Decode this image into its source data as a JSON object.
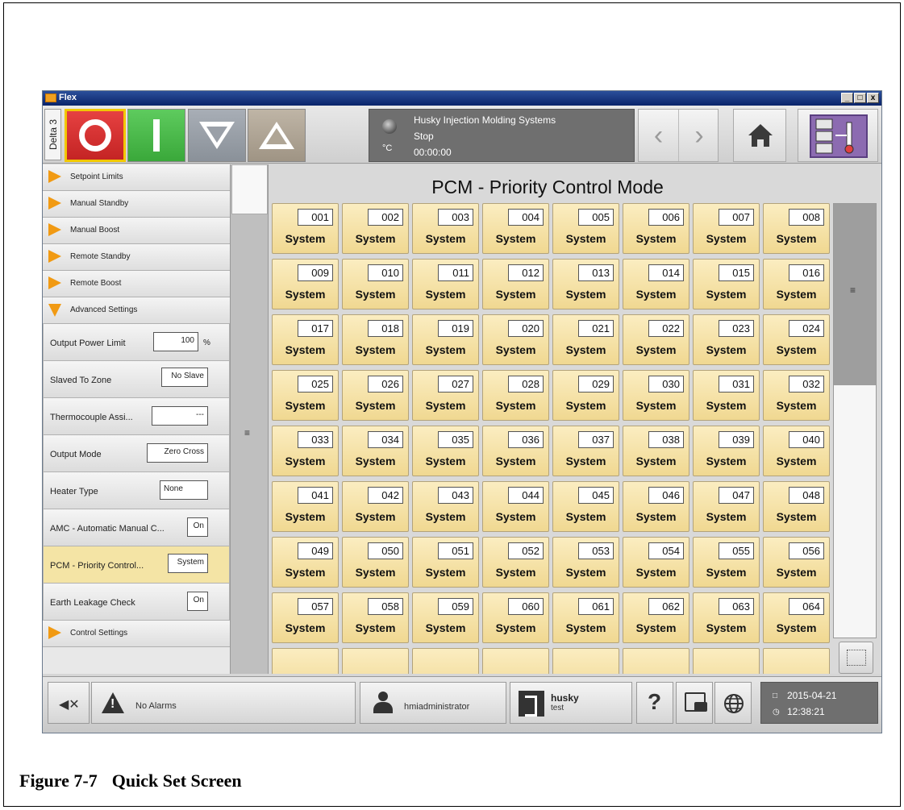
{
  "window": {
    "title": "Flex",
    "controls": {
      "minimize": "_",
      "maximize": "□",
      "close": "x"
    }
  },
  "topbar": {
    "delta_tab": "Delta 3",
    "status": {
      "company": "Husky Injection Molding Systems",
      "state": "Stop",
      "timer": "00:00:00",
      "unit": "°C"
    },
    "colors": {
      "stop": "#d83030",
      "start": "#4bbd4b",
      "stop_border": "#f2c700",
      "monitor": "#8c6bb1"
    },
    "icons": [
      "stop-icon",
      "start-icon",
      "decrease-icon",
      "increase-icon",
      "back-icon",
      "forward-icon",
      "home-icon",
      "temperature-monitor-icon"
    ]
  },
  "sidebar": {
    "menu": [
      {
        "label": "Setpoint Limits",
        "expanded": false
      },
      {
        "label": "Manual Standby",
        "expanded": false
      },
      {
        "label": "Manual Boost",
        "expanded": false
      },
      {
        "label": "Remote Standby",
        "expanded": false
      },
      {
        "label": "Remote Boost",
        "expanded": false
      },
      {
        "label": "Advanced Settings",
        "expanded": true
      }
    ],
    "props": [
      {
        "label": "Output Power Limit",
        "value": "100",
        "unit": "%"
      },
      {
        "label": "Slaved To Zone",
        "value": "No Slave"
      },
      {
        "label": "Thermocouple Assi...",
        "value": "---"
      },
      {
        "label": "Output Mode",
        "value": "Zero Cross"
      },
      {
        "label": "Heater Type",
        "value": "None"
      },
      {
        "label": "AMC - Automatic Manual C...",
        "value": "On"
      },
      {
        "label": "PCM - Priority Control...",
        "value": "System",
        "selected": true
      },
      {
        "label": "Earth Leakage Check",
        "value": "On"
      }
    ],
    "footer_menu": {
      "label": "Control Settings"
    },
    "scroll_grip": "≡"
  },
  "main": {
    "title": "PCM - Priority Control Mode",
    "zones": [
      {
        "num": "001",
        "label": "System"
      },
      {
        "num": "002",
        "label": "System"
      },
      {
        "num": "003",
        "label": "System"
      },
      {
        "num": "004",
        "label": "System"
      },
      {
        "num": "005",
        "label": "System"
      },
      {
        "num": "006",
        "label": "System"
      },
      {
        "num": "007",
        "label": "System"
      },
      {
        "num": "008",
        "label": "System"
      },
      {
        "num": "009",
        "label": "System"
      },
      {
        "num": "010",
        "label": "System"
      },
      {
        "num": "011",
        "label": "System"
      },
      {
        "num": "012",
        "label": "System"
      },
      {
        "num": "013",
        "label": "System"
      },
      {
        "num": "014",
        "label": "System"
      },
      {
        "num": "015",
        "label": "System"
      },
      {
        "num": "016",
        "label": "System"
      },
      {
        "num": "017",
        "label": "System"
      },
      {
        "num": "018",
        "label": "System"
      },
      {
        "num": "019",
        "label": "System"
      },
      {
        "num": "020",
        "label": "System"
      },
      {
        "num": "021",
        "label": "System"
      },
      {
        "num": "022",
        "label": "System"
      },
      {
        "num": "023",
        "label": "System"
      },
      {
        "num": "024",
        "label": "System"
      },
      {
        "num": "025",
        "label": "System"
      },
      {
        "num": "026",
        "label": "System"
      },
      {
        "num": "027",
        "label": "System"
      },
      {
        "num": "028",
        "label": "System"
      },
      {
        "num": "029",
        "label": "System"
      },
      {
        "num": "030",
        "label": "System"
      },
      {
        "num": "031",
        "label": "System"
      },
      {
        "num": "032",
        "label": "System"
      },
      {
        "num": "033",
        "label": "System"
      },
      {
        "num": "034",
        "label": "System"
      },
      {
        "num": "035",
        "label": "System"
      },
      {
        "num": "036",
        "label": "System"
      },
      {
        "num": "037",
        "label": "System"
      },
      {
        "num": "038",
        "label": "System"
      },
      {
        "num": "039",
        "label": "System"
      },
      {
        "num": "040",
        "label": "System"
      },
      {
        "num": "041",
        "label": "System"
      },
      {
        "num": "042",
        "label": "System"
      },
      {
        "num": "043",
        "label": "System"
      },
      {
        "num": "044",
        "label": "System"
      },
      {
        "num": "045",
        "label": "System"
      },
      {
        "num": "046",
        "label": "System"
      },
      {
        "num": "047",
        "label": "System"
      },
      {
        "num": "048",
        "label": "System"
      },
      {
        "num": "049",
        "label": "System"
      },
      {
        "num": "050",
        "label": "System"
      },
      {
        "num": "051",
        "label": "System"
      },
      {
        "num": "052",
        "label": "System"
      },
      {
        "num": "053",
        "label": "System"
      },
      {
        "num": "054",
        "label": "System"
      },
      {
        "num": "055",
        "label": "System"
      },
      {
        "num": "056",
        "label": "System"
      },
      {
        "num": "057",
        "label": "System"
      },
      {
        "num": "058",
        "label": "System"
      },
      {
        "num": "059",
        "label": "System"
      },
      {
        "num": "060",
        "label": "System"
      },
      {
        "num": "061",
        "label": "System"
      },
      {
        "num": "062",
        "label": "System"
      },
      {
        "num": "063",
        "label": "System"
      },
      {
        "num": "064",
        "label": "System"
      }
    ],
    "scroll_grip": "≡",
    "tile_color": "#f4e2a6"
  },
  "bottombar": {
    "alarm": "No Alarms",
    "user": "hmiadministrator",
    "brand": {
      "name": "husky",
      "sub": "test"
    },
    "help": "?",
    "date": "2015-04-21",
    "time": "12:38:21",
    "icons": [
      "mute-icon",
      "warning-icon",
      "user-icon",
      "husky-logo-icon",
      "help-icon",
      "screenshot-icon",
      "globe-icon",
      "calendar-icon",
      "clock-icon"
    ]
  },
  "caption": {
    "figure": "Figure 7-7",
    "title": "Quick Set Screen"
  }
}
